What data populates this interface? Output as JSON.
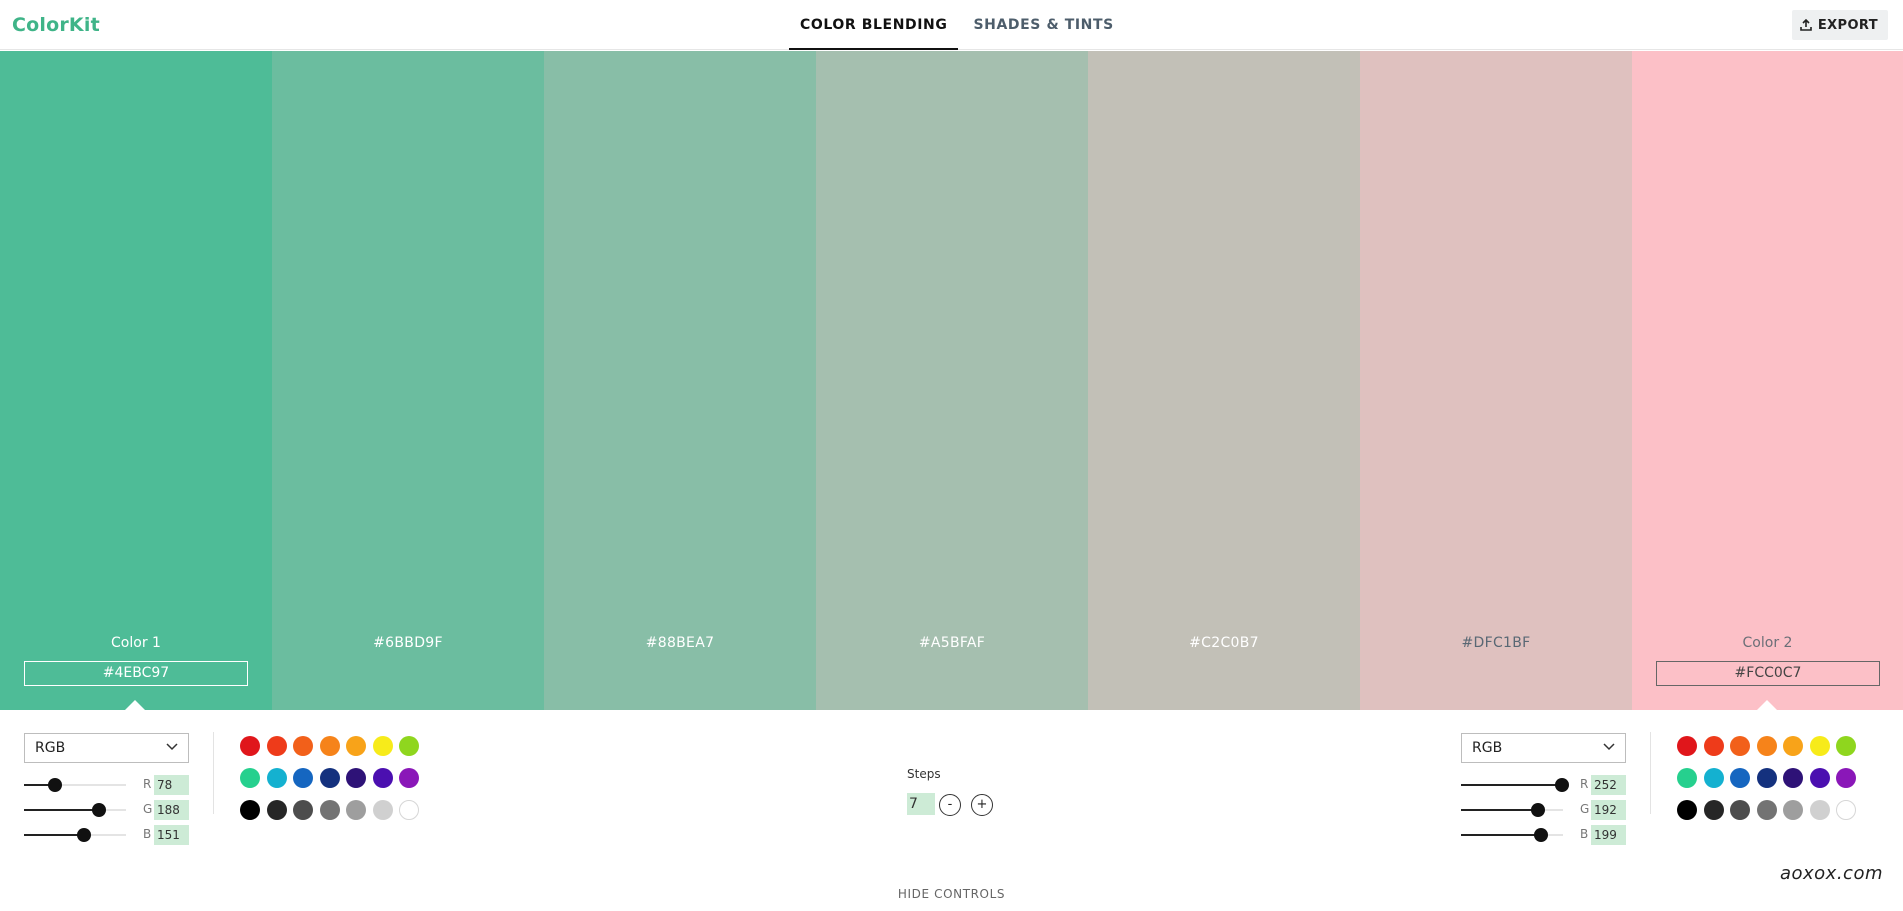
{
  "app": {
    "logo": "ColorKit"
  },
  "tabs": [
    {
      "label": "COLOR BLENDING",
      "active": true
    },
    {
      "label": "SHADES & TINTS",
      "active": false
    }
  ],
  "export_label": "EXPORT",
  "swatches": [
    {
      "hex": "#4EBC97",
      "title": "Color 1"
    },
    {
      "hex": "#6BBD9F"
    },
    {
      "hex": "#88BEA7"
    },
    {
      "hex": "#A5BFAF"
    },
    {
      "hex": "#C2C0B7"
    },
    {
      "hex": "#DFC1BF"
    },
    {
      "hex": "#FCC0C7",
      "title": "Color 2"
    }
  ],
  "color1": {
    "mode": "RGB",
    "channels": [
      {
        "label": "R",
        "value": "78"
      },
      {
        "label": "G",
        "value": "188"
      },
      {
        "label": "B",
        "value": "151"
      }
    ]
  },
  "color2": {
    "mode": "RGB",
    "channels": [
      {
        "label": "R",
        "value": "252"
      },
      {
        "label": "G",
        "value": "192"
      },
      {
        "label": "B",
        "value": "199"
      }
    ]
  },
  "palette": [
    [
      "#e0161b",
      "#ee3b1a",
      "#f2601a",
      "#f6831a",
      "#f8a319",
      "#f7eb1a",
      "#8fd61e"
    ],
    [
      "#26d08e",
      "#14b1d0",
      "#1566c0",
      "#14317e",
      "#2e1277",
      "#4b0fb0",
      "#8a17b8"
    ],
    [
      "#000000",
      "#262626",
      "#4d4d4d",
      "#737373",
      "#9e9e9e",
      "#d0d0d0",
      "#ffffff"
    ]
  ],
  "steps": {
    "label": "Steps",
    "value": "7",
    "minus": "-",
    "plus": "+"
  },
  "hide_controls": "HIDE CONTROLS",
  "watermark": "aoxox.com"
}
